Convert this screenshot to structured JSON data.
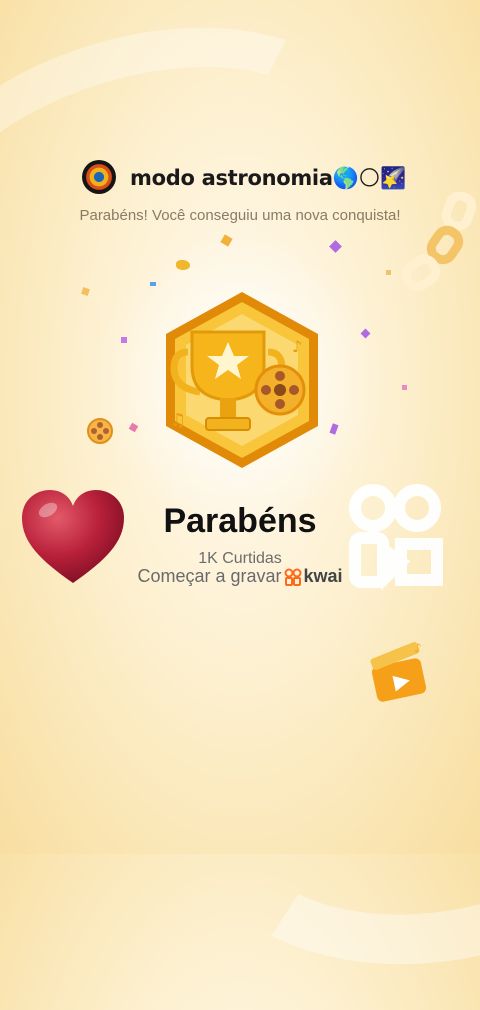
{
  "header": {
    "username": "modo astronomia🌎🌕🌠"
  },
  "subtitle": "Parabéns! Você conseguiu uma nova conquista!",
  "achievement": {
    "title": "Parabéns",
    "metric": "1K Curtidas"
  },
  "cta": {
    "label": "Começar a gravar",
    "brand": "kwai"
  },
  "icons": [
    "avatar",
    "trophy-badge-icon",
    "heart-icon",
    "kwai-watermark-icon",
    "film-reel-icon",
    "clapper-icon",
    "chain-decoration"
  ],
  "colors": {
    "background": "#fdf0cf",
    "badge_gold": "#f5b316",
    "heart_red": "#b5223a",
    "kwai_orange": "#ff6a1a"
  }
}
